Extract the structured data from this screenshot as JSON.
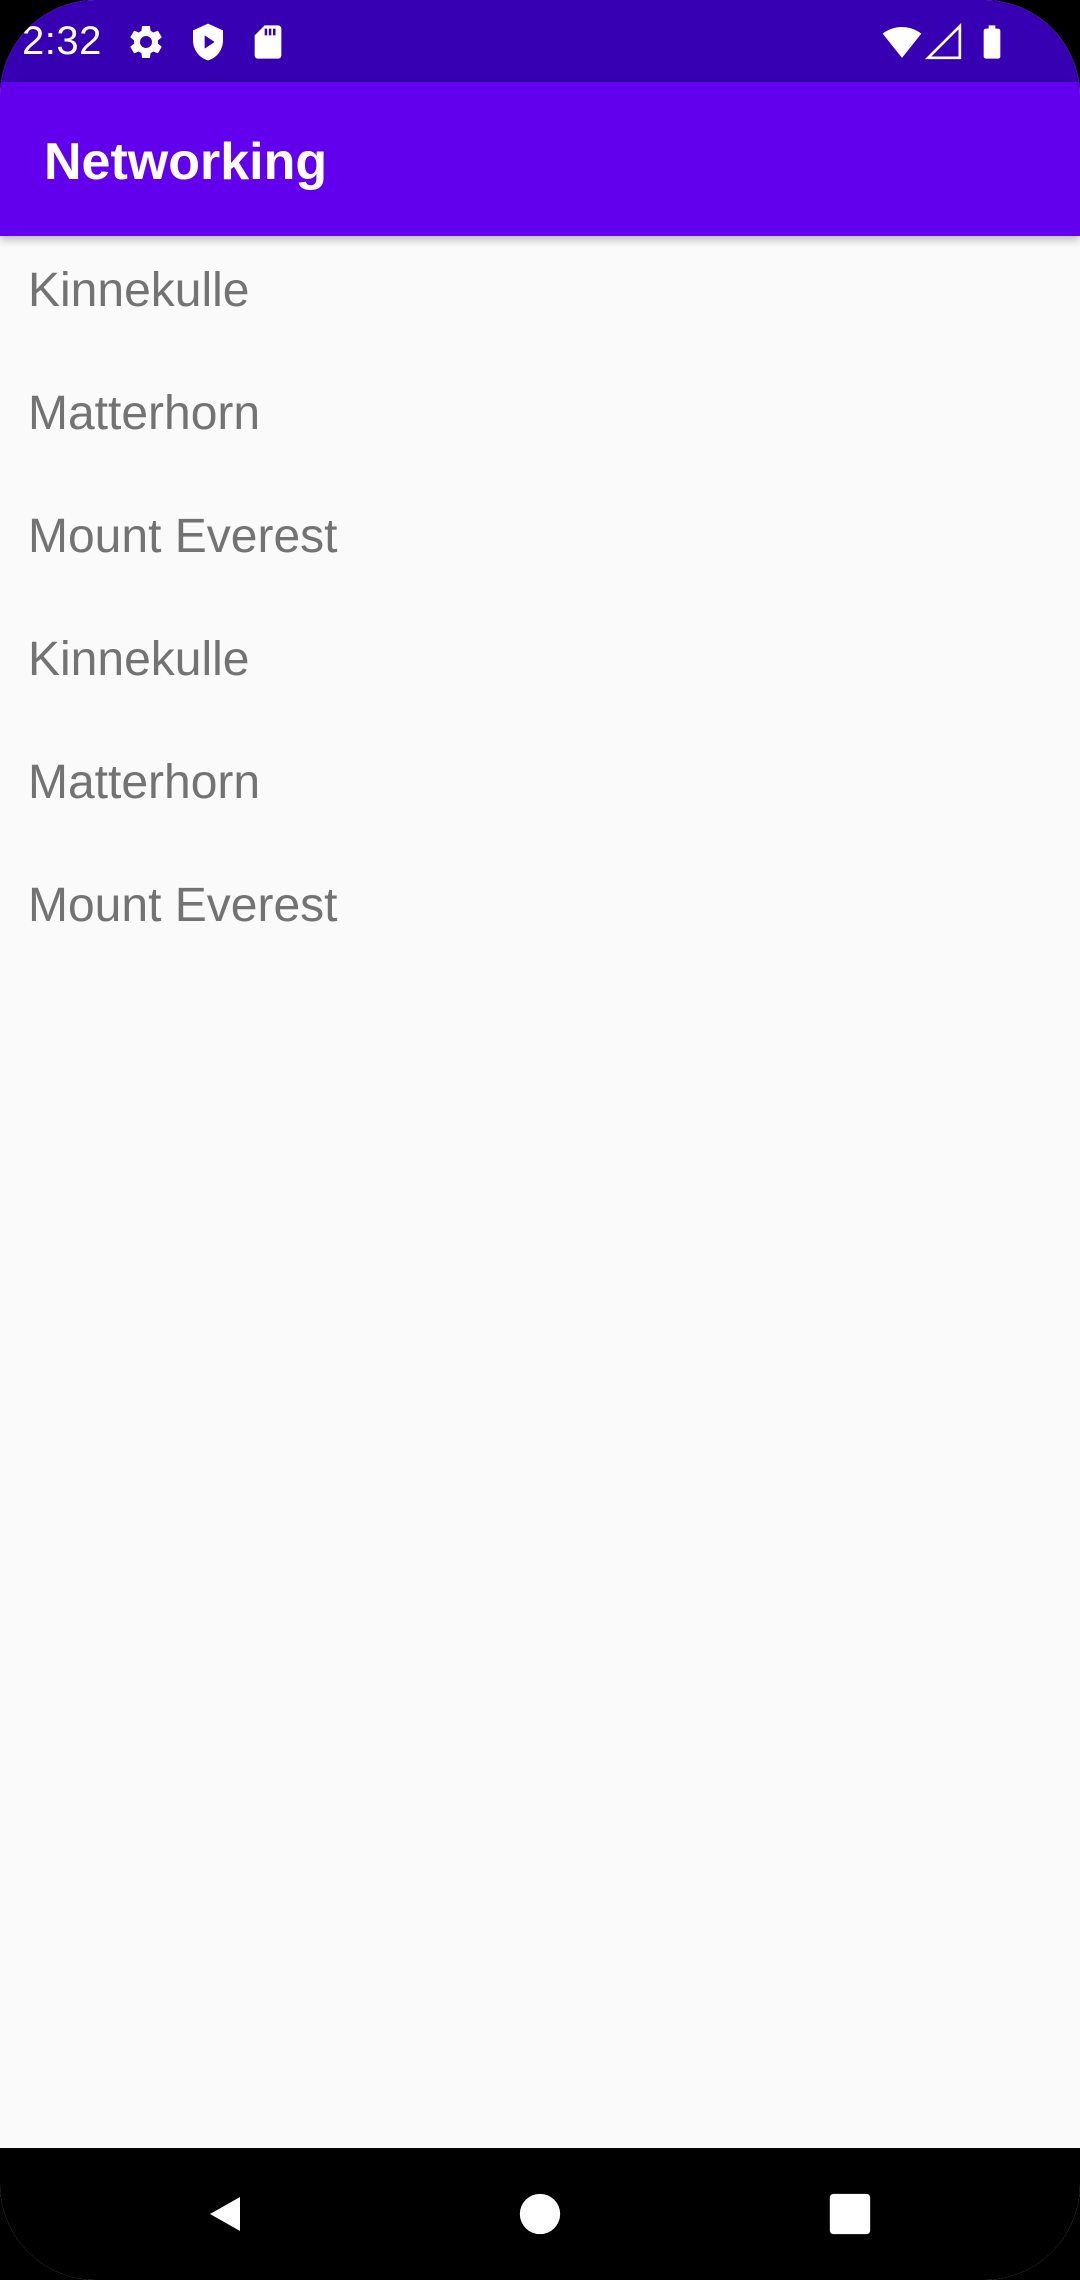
{
  "status_bar": {
    "time": "2:32",
    "left_icons": [
      "settings-icon",
      "shield-play-icon",
      "sd-card-icon"
    ],
    "right_icons": [
      "wifi-icon",
      "cellular-signal-icon",
      "battery-icon"
    ]
  },
  "app_bar": {
    "title": "Networking"
  },
  "list": {
    "items": [
      {
        "label": "Kinnekulle"
      },
      {
        "label": "Matterhorn"
      },
      {
        "label": "Mount Everest"
      },
      {
        "label": "Kinnekulle"
      },
      {
        "label": "Matterhorn"
      },
      {
        "label": "Mount Everest"
      }
    ]
  },
  "navigation": {
    "buttons": [
      "back-icon",
      "home-icon",
      "recents-icon"
    ]
  },
  "colors": {
    "status_bar": "#3700b3",
    "app_bar": "#6200ee",
    "background": "#fafafa",
    "list_text": "#737373",
    "nav_bar": "#000000"
  }
}
